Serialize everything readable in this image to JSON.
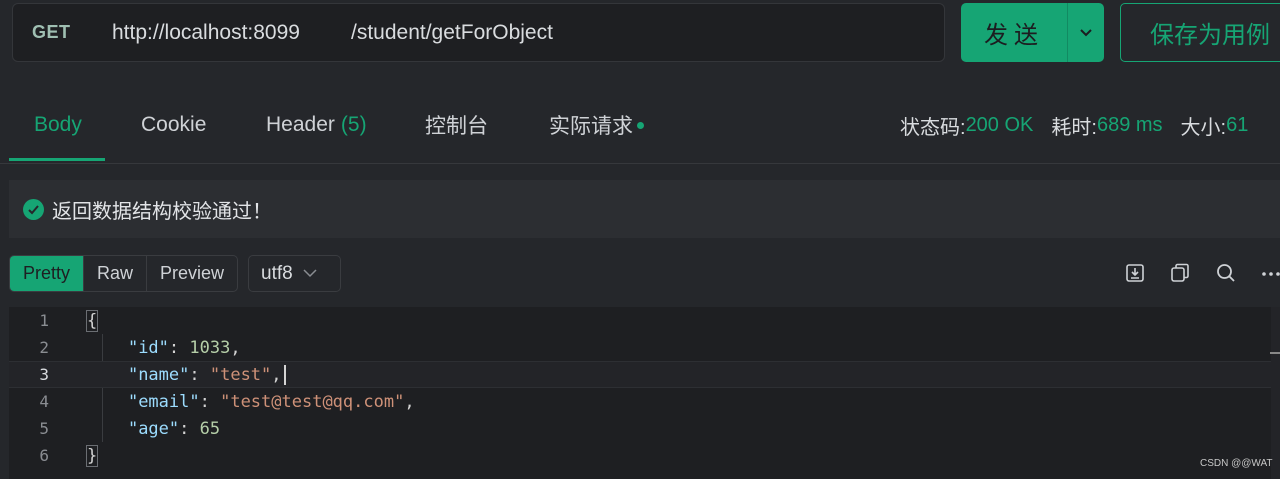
{
  "request": {
    "method": "GET",
    "host": "http://localhost:8099",
    "path": "/student/getForObject"
  },
  "actions": {
    "send_label": "发送",
    "save_label": "保存为用例"
  },
  "tabs": [
    {
      "label": "Body",
      "active": true
    },
    {
      "label": "Cookie"
    },
    {
      "label": "Header",
      "count": "(5)"
    },
    {
      "label": "控制台"
    },
    {
      "label": "实际请求"
    }
  ],
  "metrics": {
    "status_label": "状态码:",
    "status_value": "200 OK",
    "time_label": "耗时:",
    "time_value": "689 ms",
    "size_label": "大小:",
    "size_value": "61"
  },
  "validation": {
    "message": "返回数据结构校验通过！"
  },
  "view_modes": [
    "Pretty",
    "Raw",
    "Preview"
  ],
  "encoding": "utf8",
  "icons": [
    "download-icon",
    "copy-icon",
    "search-icon",
    "more-icon"
  ],
  "editor": {
    "line_numbers": [
      "1",
      "2",
      "3",
      "4",
      "5",
      "6"
    ],
    "json": {
      "open": "{",
      "close": "}",
      "fields": [
        {
          "key": "\"id\"",
          "value": "1033",
          "kind": "number",
          "comma": ","
        },
        {
          "key": "\"name\"",
          "value": "\"test\"",
          "kind": "string",
          "comma": ","
        },
        {
          "key": "\"email\"",
          "value": "\"test@test@qq.com\"",
          "kind": "string",
          "comma": ","
        },
        {
          "key": "\"age\"",
          "value": "65",
          "kind": "number",
          "comma": ""
        }
      ]
    }
  },
  "colors": {
    "accent": "#16a574",
    "background": "#25272b",
    "editor_bg": "#1e1f22",
    "string": "#ce9178",
    "number": "#b5cea8",
    "key": "#9cdcfe"
  },
  "watermark": "CSDN @@WAT"
}
